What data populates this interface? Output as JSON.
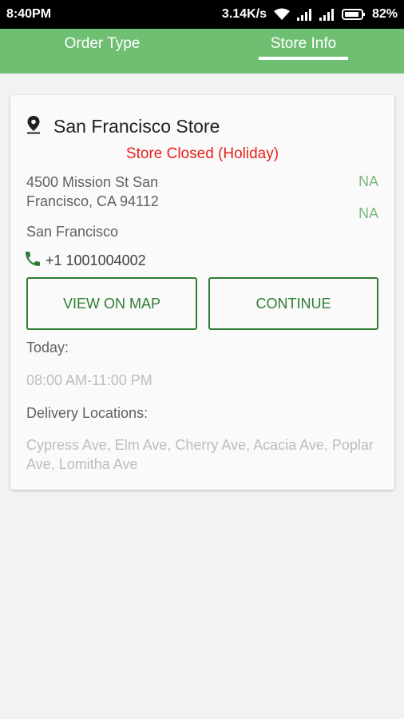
{
  "status_bar": {
    "time": "8:40PM",
    "network_speed": "3.14K/s",
    "battery": "82%",
    "icons": [
      "wifi-icon",
      "signal-icon",
      "signal-icon",
      "battery-icon"
    ]
  },
  "tabs": [
    {
      "label": "Order Type",
      "selected": false
    },
    {
      "label": "Store Info",
      "selected": true
    }
  ],
  "store": {
    "icon": "location-pin-icon",
    "name": "San Francisco Store",
    "status": "Store Closed (Holiday)",
    "address": "4500 Mission St San Francisco, CA 94112",
    "na_1": "NA",
    "na_2": "NA",
    "city": "San Francisco",
    "phone_icon": "phone-icon",
    "phone": "+1 1001004002",
    "view_on_map_label": "VIEW ON MAP",
    "continue_label": "CONTINUE",
    "today_label": "Today:",
    "hours": "08:00 AM-11:00 PM",
    "delivery_label": "Delivery Locations:",
    "delivery_locations": "Cypress Ave, Elm Ave, Cherry Ave, Acacia Ave, Poplar Ave, Lomitha Ave"
  },
  "colors": {
    "tab_bar": "#6fbf73",
    "accent_green": "#2e7d32",
    "closed_red": "#e8211d",
    "na_green": "#7cb87e"
  }
}
